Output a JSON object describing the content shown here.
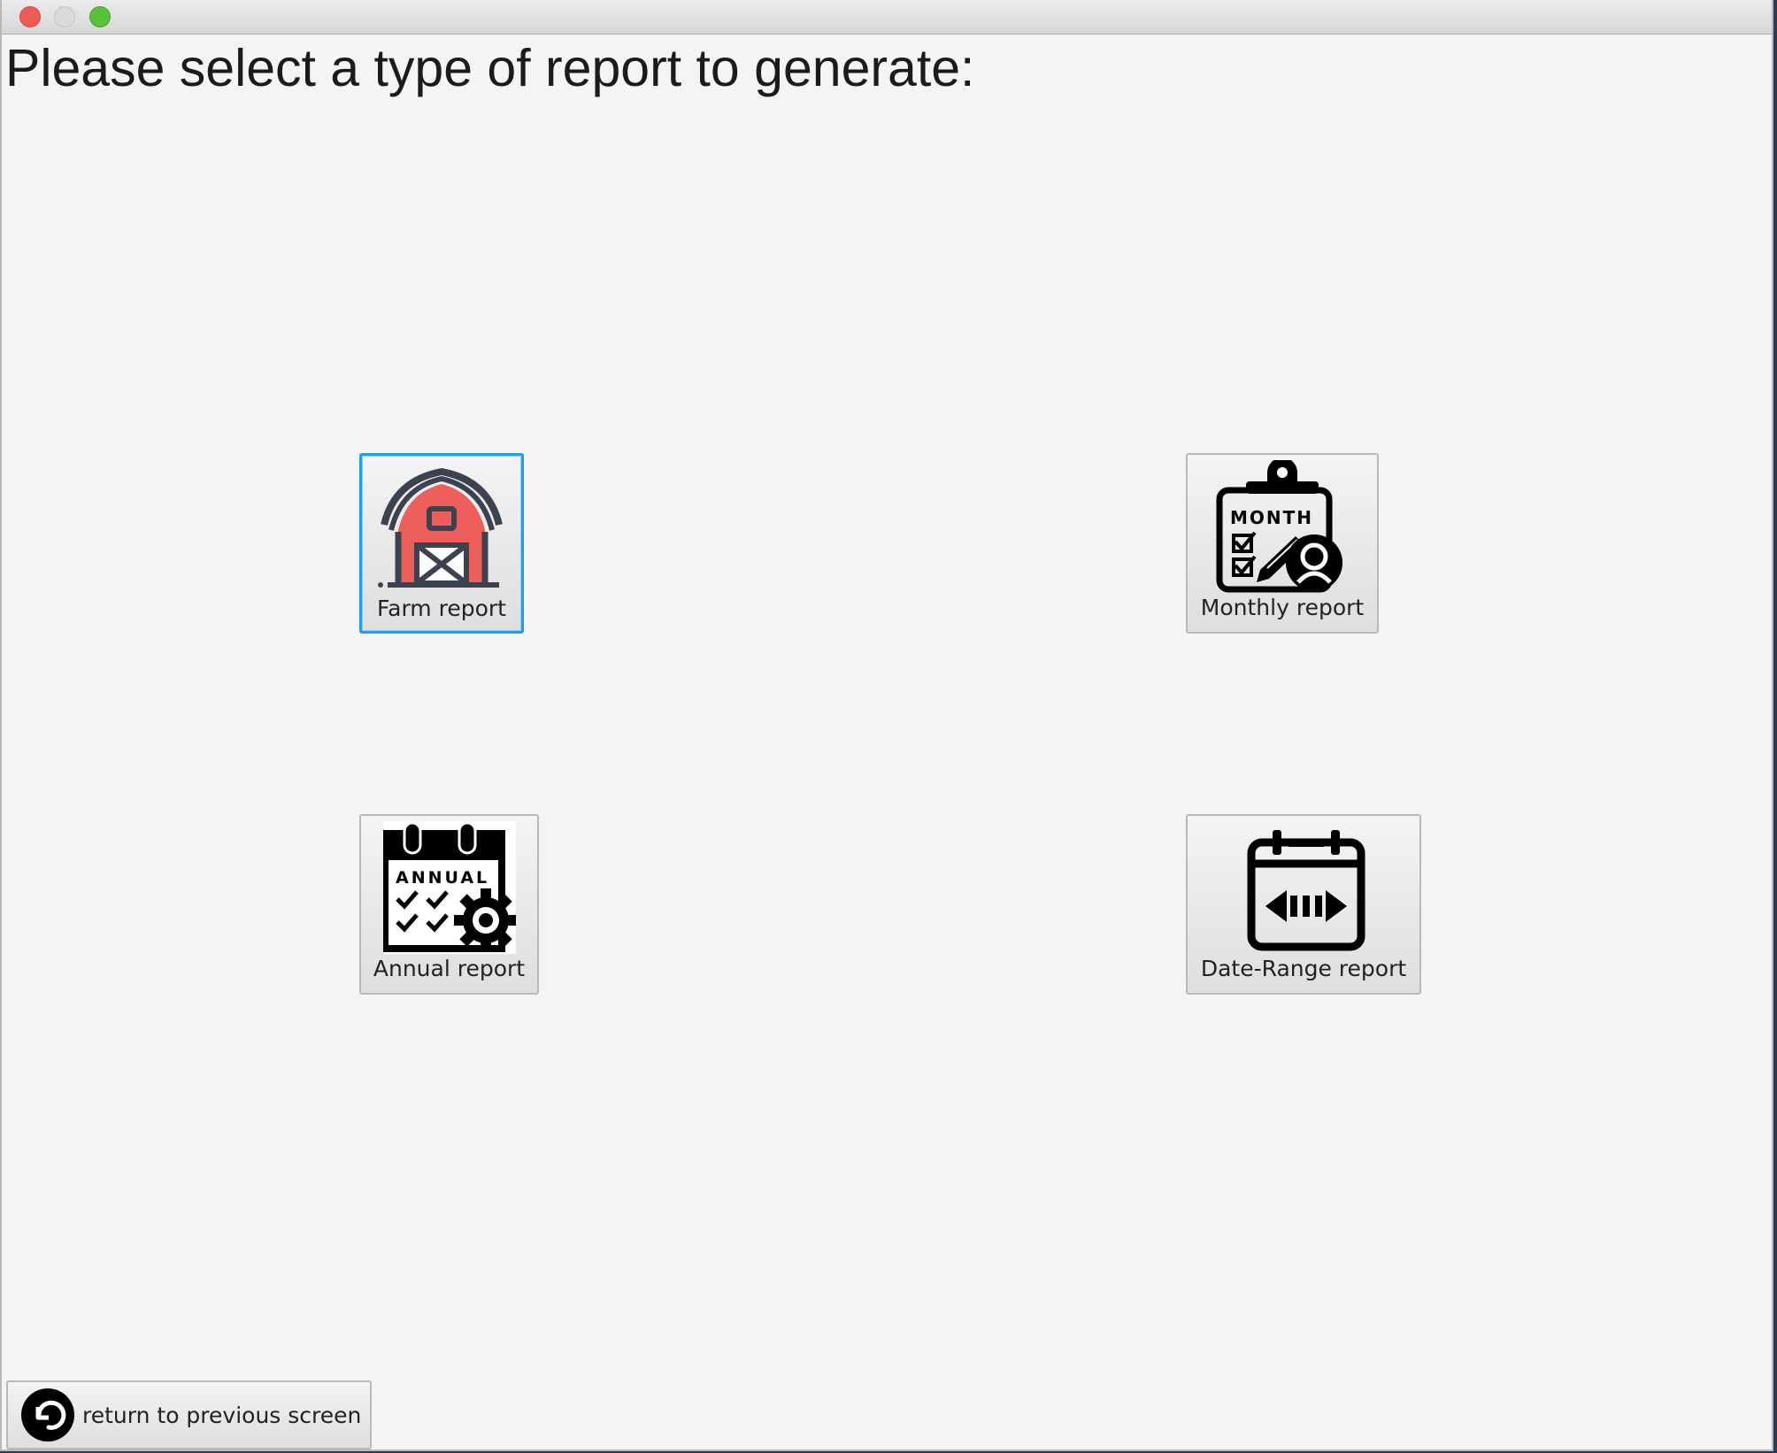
{
  "window": {
    "title": ""
  },
  "header": {
    "prompt": "Please select a type of report to generate:"
  },
  "reports": {
    "farm": {
      "label": "Farm report",
      "icon": "barn-icon",
      "focused": true
    },
    "monthly": {
      "label": "Monthly report",
      "icon": "month-clipboard-icon",
      "icon_text": "MONTH"
    },
    "annual": {
      "label": "Annual report",
      "icon": "annual-calendar-gear-icon",
      "icon_text": "ANNUAL"
    },
    "range": {
      "label": "Date-Range report",
      "icon": "calendar-range-icon"
    }
  },
  "footer": {
    "back_label": "return to previous screen",
    "back_icon": "return-arrow-icon"
  },
  "colors": {
    "background": "#f4f4f4",
    "focus_ring": "#1f9fe8",
    "barn_red": "#ee5f5b",
    "barn_outline": "#3c4250",
    "close": "#ee5c55",
    "minimize": "#dadada",
    "maximize": "#5ac13d"
  }
}
